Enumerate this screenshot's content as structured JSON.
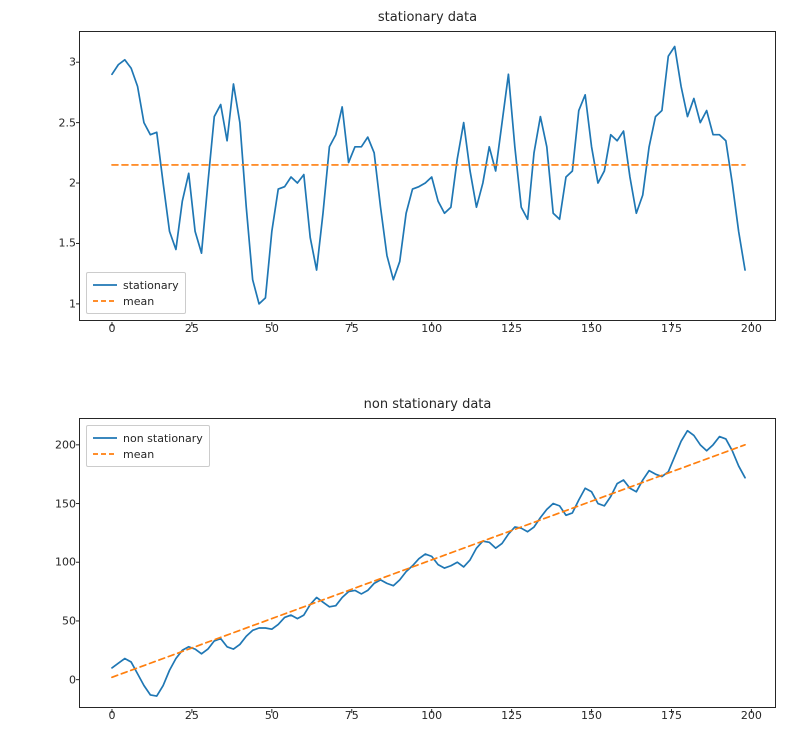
{
  "chart_data": [
    {
      "type": "line",
      "title": "stationary data",
      "xlim": [
        -10,
        208
      ],
      "ylim": [
        0.85,
        3.25
      ],
      "xticks": [
        0,
        25,
        50,
        75,
        100,
        125,
        150,
        175,
        200
      ],
      "yticks": [
        1.0,
        1.5,
        2.0,
        2.5,
        3.0
      ],
      "legend_position": "lower-left",
      "legend": [
        {
          "name": "stationary",
          "style": "solid",
          "color": "#1f77b4"
        },
        {
          "name": "mean",
          "style": "dashed",
          "color": "#ff7f0e"
        }
      ],
      "series": [
        {
          "name": "stationary",
          "style": "solid",
          "color": "#1f77b4",
          "x": [
            0,
            2,
            4,
            6,
            8,
            10,
            12,
            14,
            16,
            18,
            20,
            22,
            24,
            26,
            28,
            30,
            32,
            34,
            36,
            38,
            40,
            42,
            44,
            46,
            48,
            50,
            52,
            54,
            56,
            58,
            60,
            62,
            64,
            66,
            68,
            70,
            72,
            74,
            76,
            78,
            80,
            82,
            84,
            86,
            88,
            90,
            92,
            94,
            96,
            98,
            100,
            102,
            104,
            106,
            108,
            110,
            112,
            114,
            116,
            118,
            120,
            122,
            124,
            126,
            128,
            130,
            132,
            134,
            136,
            138,
            140,
            142,
            144,
            146,
            148,
            150,
            152,
            154,
            156,
            158,
            160,
            162,
            164,
            166,
            168,
            170,
            172,
            174,
            176,
            178,
            180,
            182,
            184,
            186,
            188,
            190,
            192,
            194,
            196,
            198
          ],
          "values": [
            2.9,
            2.98,
            3.02,
            2.95,
            2.8,
            2.5,
            2.4,
            2.42,
            2.0,
            1.6,
            1.45,
            1.85,
            2.08,
            1.6,
            1.42,
            2.0,
            2.55,
            2.65,
            2.35,
            2.82,
            2.5,
            1.8,
            1.2,
            1.0,
            1.05,
            1.6,
            1.95,
            1.97,
            2.05,
            2.0,
            2.07,
            1.55,
            1.28,
            1.75,
            2.3,
            2.4,
            2.63,
            2.17,
            2.3,
            2.3,
            2.38,
            2.25,
            1.8,
            1.4,
            1.2,
            1.35,
            1.75,
            1.95,
            1.97,
            2.0,
            2.05,
            1.85,
            1.75,
            1.8,
            2.2,
            2.5,
            2.1,
            1.8,
            2.0,
            2.3,
            2.1,
            2.5,
            2.9,
            2.3,
            1.8,
            1.7,
            2.25,
            2.55,
            2.3,
            1.75,
            1.7,
            2.05,
            2.1,
            2.6,
            2.73,
            2.3,
            2.0,
            2.1,
            2.4,
            2.35,
            2.43,
            2.05,
            1.75,
            1.9,
            2.3,
            2.55,
            2.6,
            3.05,
            3.13,
            2.8,
            2.55,
            2.7,
            2.5,
            2.6,
            2.4,
            2.4,
            2.35,
            2.0,
            1.6,
            1.28
          ]
        },
        {
          "name": "mean",
          "style": "dashed",
          "color": "#ff7f0e",
          "x": [
            0,
            198
          ],
          "values": [
            2.15,
            2.15
          ]
        }
      ]
    },
    {
      "type": "line",
      "title": "non stationary data",
      "xlim": [
        -10,
        208
      ],
      "ylim": [
        -25,
        222
      ],
      "xticks": [
        0,
        25,
        50,
        75,
        100,
        125,
        150,
        175,
        200
      ],
      "yticks": [
        0,
        50,
        100,
        150,
        200
      ],
      "legend_position": "upper-left",
      "legend": [
        {
          "name": "non stationary",
          "style": "solid",
          "color": "#1f77b4"
        },
        {
          "name": "mean",
          "style": "dashed",
          "color": "#ff7f0e"
        }
      ],
      "series": [
        {
          "name": "non stationary",
          "style": "solid",
          "color": "#1f77b4",
          "x": [
            0,
            2,
            4,
            6,
            8,
            10,
            12,
            14,
            16,
            18,
            20,
            22,
            24,
            26,
            28,
            30,
            32,
            34,
            36,
            38,
            40,
            42,
            44,
            46,
            48,
            50,
            52,
            54,
            56,
            58,
            60,
            62,
            64,
            66,
            68,
            70,
            72,
            74,
            76,
            78,
            80,
            82,
            84,
            86,
            88,
            90,
            92,
            94,
            96,
            98,
            100,
            102,
            104,
            106,
            108,
            110,
            112,
            114,
            116,
            118,
            120,
            122,
            124,
            126,
            128,
            130,
            132,
            134,
            136,
            138,
            140,
            142,
            144,
            146,
            148,
            150,
            152,
            154,
            156,
            158,
            160,
            162,
            164,
            166,
            168,
            170,
            172,
            174,
            176,
            178,
            180,
            182,
            184,
            186,
            188,
            190,
            192,
            194,
            196,
            198
          ],
          "values": [
            10,
            14,
            18,
            15,
            5,
            -5,
            -13,
            -14,
            -5,
            8,
            18,
            25,
            28,
            26,
            22,
            26,
            33,
            35,
            28,
            26,
            30,
            37,
            42,
            44,
            44,
            43,
            47,
            53,
            55,
            52,
            55,
            64,
            70,
            66,
            62,
            63,
            70,
            75,
            76,
            73,
            76,
            82,
            85,
            82,
            80,
            85,
            92,
            97,
            103,
            107,
            105,
            98,
            95,
            97,
            100,
            96,
            102,
            112,
            118,
            117,
            112,
            116,
            124,
            130,
            129,
            126,
            130,
            138,
            145,
            150,
            148,
            140,
            142,
            153,
            163,
            160,
            150,
            148,
            156,
            167,
            170,
            163,
            160,
            170,
            178,
            175,
            173,
            177,
            190,
            203,
            212,
            208,
            200,
            195,
            200,
            207,
            205,
            195,
            182,
            172
          ]
        },
        {
          "name": "mean",
          "style": "dashed",
          "color": "#ff7f0e",
          "x": [
            0,
            198
          ],
          "values": [
            2,
            200
          ]
        }
      ]
    }
  ]
}
